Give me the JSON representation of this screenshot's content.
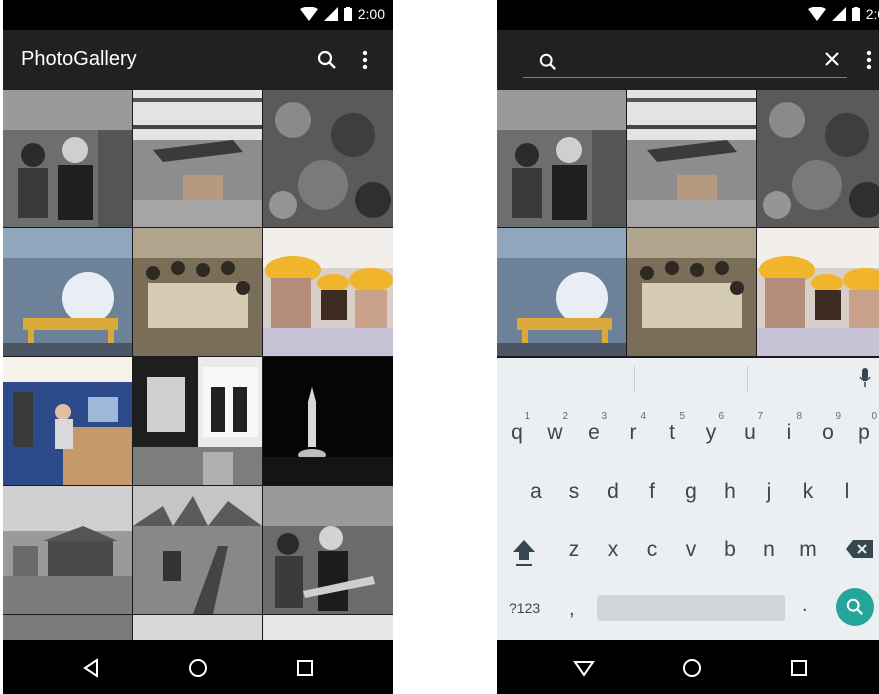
{
  "status_bar": {
    "time": "2:00"
  },
  "left_screen": {
    "app_title": "PhotoGallery",
    "actions": {
      "search_icon": "search-icon",
      "overflow_icon": "more-vert-icon"
    }
  },
  "right_screen": {
    "search": {
      "value": "",
      "placeholder": ""
    },
    "actions": {
      "clear_icon": "close-icon",
      "overflow_icon": "more-vert-icon"
    },
    "keyboard": {
      "row1": [
        "q",
        "w",
        "e",
        "r",
        "t",
        "y",
        "u",
        "i",
        "o",
        "p"
      ],
      "row1_hints": [
        "1",
        "2",
        "3",
        "4",
        "5",
        "6",
        "7",
        "8",
        "9",
        "0"
      ],
      "row2": [
        "a",
        "s",
        "d",
        "f",
        "g",
        "h",
        "j",
        "k",
        "l"
      ],
      "row3": [
        "z",
        "x",
        "c",
        "v",
        "b",
        "n",
        "m"
      ],
      "symbols_label": "?123",
      "comma_label": ",",
      "period_label": "."
    }
  },
  "photos": [
    "photo-band-guitarists",
    "photo-aircraft-hangar",
    "photo-rock-texture",
    "photo-lab-sphere",
    "photo-meeting-room",
    "photo-hardhat-workers",
    "photo-office-workers",
    "photo-portraits-collage",
    "photo-rocket-night",
    "photo-log-cabin",
    "photo-rail-trench",
    "photo-band-guitarists-2"
  ]
}
